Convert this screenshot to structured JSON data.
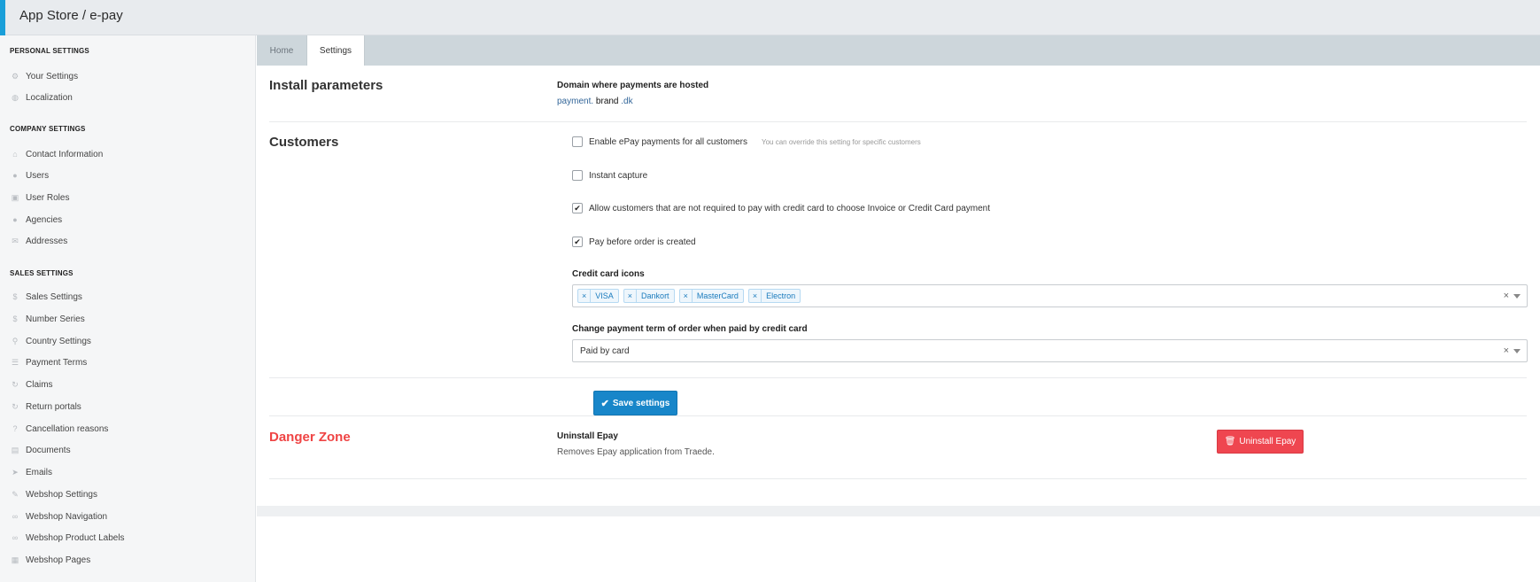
{
  "header": {
    "title": "App Store / e-pay"
  },
  "sidebar": {
    "sections": [
      {
        "heading": "PERSONAL SETTINGS",
        "items": [
          {
            "label": "Your Settings",
            "icon": "gear-icon"
          },
          {
            "label": "Localization",
            "icon": "globe-icon"
          }
        ]
      },
      {
        "heading": "COMPANY SETTINGS",
        "items": [
          {
            "label": "Contact Information",
            "icon": "home-icon"
          },
          {
            "label": "Users",
            "icon": "user-icon"
          },
          {
            "label": "User Roles",
            "icon": "lock-icon"
          },
          {
            "label": "Agencies",
            "icon": "circle-icon"
          },
          {
            "label": "Addresses",
            "icon": "envelope-icon"
          }
        ]
      },
      {
        "heading": "SALES SETTINGS",
        "items": [
          {
            "label": "Sales Settings",
            "icon": "dollar-icon"
          },
          {
            "label": "Number Series",
            "icon": "dollar-icon"
          },
          {
            "label": "Country Settings",
            "icon": "map-pin-icon"
          },
          {
            "label": "Payment Terms",
            "icon": "list-icon"
          },
          {
            "label": "Claims",
            "icon": "refresh-icon"
          },
          {
            "label": "Return portals",
            "icon": "refresh-icon"
          },
          {
            "label": "Cancellation reasons",
            "icon": "question-icon"
          },
          {
            "label": "Documents",
            "icon": "document-icon"
          },
          {
            "label": "Emails",
            "icon": "send-icon"
          },
          {
            "label": "Webshop Settings",
            "icon": "wrench-icon"
          },
          {
            "label": "Webshop Navigation",
            "icon": "link-icon"
          },
          {
            "label": "Webshop Product Labels",
            "icon": "link-icon"
          },
          {
            "label": "Webshop Pages",
            "icon": "page-icon"
          }
        ]
      }
    ]
  },
  "tabs": [
    {
      "label": "Home",
      "active": false
    },
    {
      "label": "Settings",
      "active": true
    }
  ],
  "install": {
    "title": "Install parameters",
    "domain_label": "Domain where payments are hosted",
    "domain_prefix": "payment.",
    "domain_value": "brand",
    "domain_suffix": ".dk"
  },
  "customers": {
    "title": "Customers",
    "checkboxes": [
      {
        "label": "Enable ePay payments for all customers",
        "checked": false,
        "hint": "You can override this setting for specific customers"
      },
      {
        "label": "Instant capture",
        "checked": false,
        "hint": ""
      },
      {
        "label": "Allow customers that are not required to pay with credit card to choose Invoice or Credit Card payment",
        "checked": true,
        "hint": ""
      },
      {
        "label": "Pay before order is created",
        "checked": true,
        "hint": ""
      }
    ],
    "cc_icons_label": "Credit card icons",
    "cc_icons": [
      "VISA",
      "Dankort",
      "MasterCard",
      "Electron"
    ],
    "payment_term_label": "Change payment term of order when paid by credit card",
    "payment_term_value": "Paid by card"
  },
  "save_button": {
    "label": "Save settings"
  },
  "danger": {
    "title": "Danger Zone",
    "uninstall_title": "Uninstall Epay",
    "uninstall_desc": "Removes Epay application from Traede.",
    "uninstall_button": "Uninstall Epay"
  },
  "colors": {
    "accent": "#1a9fd9",
    "primary_button": "#1886c9",
    "danger": "#ef4444",
    "tag": "#1a7bbd"
  }
}
